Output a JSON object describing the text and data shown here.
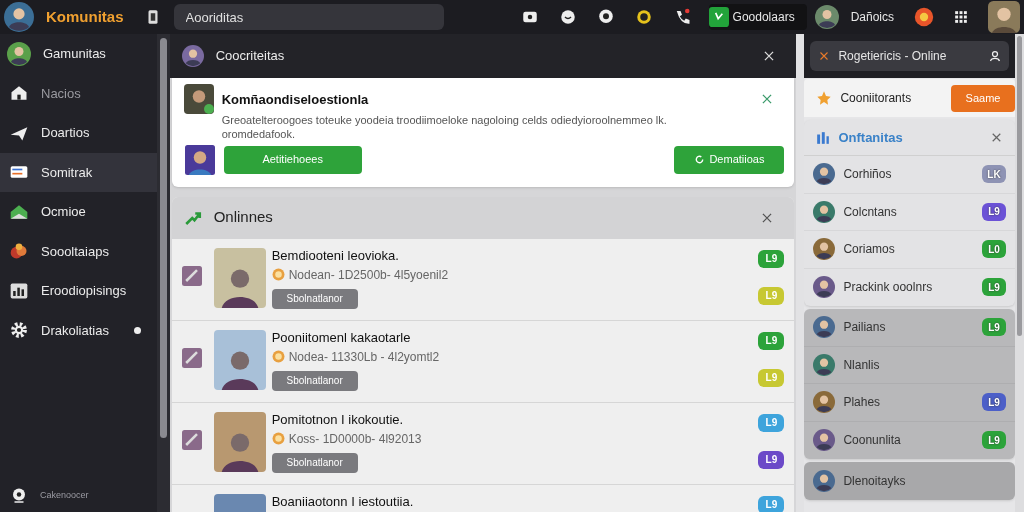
{
  "top_bar": {
    "brand": "Komunitas",
    "search": {
      "value": "Aooriditas"
    },
    "action_button": "Goodolaars",
    "user_name": "Dañoics"
  },
  "sidebar": {
    "items": [
      {
        "label": "Gamunitas",
        "kind": "avatar",
        "selected": false,
        "dimmed": false,
        "dot": false
      },
      {
        "label": "Nacios",
        "kind": "home",
        "selected": false,
        "dimmed": true,
        "dot": false
      },
      {
        "label": "Doartios",
        "kind": "plane",
        "selected": false,
        "dimmed": false,
        "dot": false
      },
      {
        "label": "Somitrak",
        "kind": "card",
        "selected": true,
        "dimmed": false,
        "dot": false
      },
      {
        "label": "Ocmioe",
        "kind": "house",
        "selected": false,
        "dimmed": false,
        "dot": false
      },
      {
        "label": "Soooltaiaps",
        "kind": "fruit",
        "selected": false,
        "dimmed": false,
        "dot": false
      },
      {
        "label": "Eroodiopisings",
        "kind": "chart",
        "selected": false,
        "dimmed": false,
        "dot": false
      },
      {
        "label": "Drakoliatias",
        "kind": "gear",
        "selected": false,
        "dimmed": false,
        "dot": true
      }
    ],
    "footer": "Cakenoocer"
  },
  "main": {
    "title": "Coocriteitas",
    "notification": {
      "title": "Komñaondiseloestionla",
      "body": "Greoatelteroogoes toteuke yoodeia troodiimoeloke nagoloing celds odiedyioroolnemmeo lk. oromdedafook.",
      "accept_button": "Aetitiehoees",
      "action_button": "Dematiioas"
    },
    "section": {
      "title": "Onlinnes",
      "rows": [
        {
          "title": "Bemdiooteni leovioka.",
          "meta": "Nodean- 1D2500b- 4l5yoenil2",
          "button": "Sbolnatlanor",
          "badges": [
            {
              "text": "L9",
              "color": "#2ca33a"
            },
            {
              "text": "L9",
              "color": "#c7c832"
            }
          ]
        },
        {
          "title": "Pooniitomenl kakaotarle",
          "meta": "Nodea- 11330Lb - 4l2yomtl2",
          "button": "Sbolnatlanor",
          "badges": [
            {
              "text": "L9",
              "color": "#2ca33a"
            },
            {
              "text": "L9",
              "color": "#c7c832"
            }
          ]
        },
        {
          "title": "Pomitotnon I ikokoutie.",
          "meta": "Koss- 1D0000b- 4l92013",
          "button": "Sbolnatlanor",
          "badges": [
            {
              "text": "L9",
              "color": "#3ea4dc"
            },
            {
              "text": "L9",
              "color": "#6b49c8"
            }
          ]
        },
        {
          "title": "Boaniiaotonn I iestoutiia.",
          "meta": "",
          "button": "",
          "badges": [
            {
              "text": "L9",
              "color": "#3ea4dc"
            }
          ]
        }
      ]
    }
  },
  "right_panel": {
    "header": "Rogetiericis - Online",
    "promo": {
      "label": "Cooniitorants",
      "button": "Saame"
    },
    "group_title": "Onftanitas",
    "groups": [
      {
        "rows": [
          {
            "name": "Corhiños",
            "badge": {
              "text": "LK",
              "color": "#8e93b4"
            }
          },
          {
            "name": "Colcntans",
            "badge": {
              "text": "L9",
              "color": "#6b52d6"
            }
          },
          {
            "name": "Coriamos",
            "badge": {
              "text": "L0",
              "color": "#2ca33a"
            }
          },
          {
            "name": "Prackink ooolnrs",
            "badge": {
              "text": "L9",
              "color": "#2ca33a"
            }
          }
        ]
      },
      {
        "rows": [
          {
            "name": "Pailians",
            "badge": {
              "text": "L9",
              "color": "#2ca33a"
            }
          },
          {
            "name": "Nlanlis"
          },
          {
            "name": "Plahes",
            "badge": {
              "text": "L9",
              "color": "#4c5fc8"
            }
          },
          {
            "name": "Coonunlita",
            "badge": {
              "text": "L9",
              "color": "#2ca33a"
            }
          }
        ]
      },
      {
        "rows": [
          {
            "name": "Dlenoitayks"
          }
        ]
      }
    ]
  }
}
